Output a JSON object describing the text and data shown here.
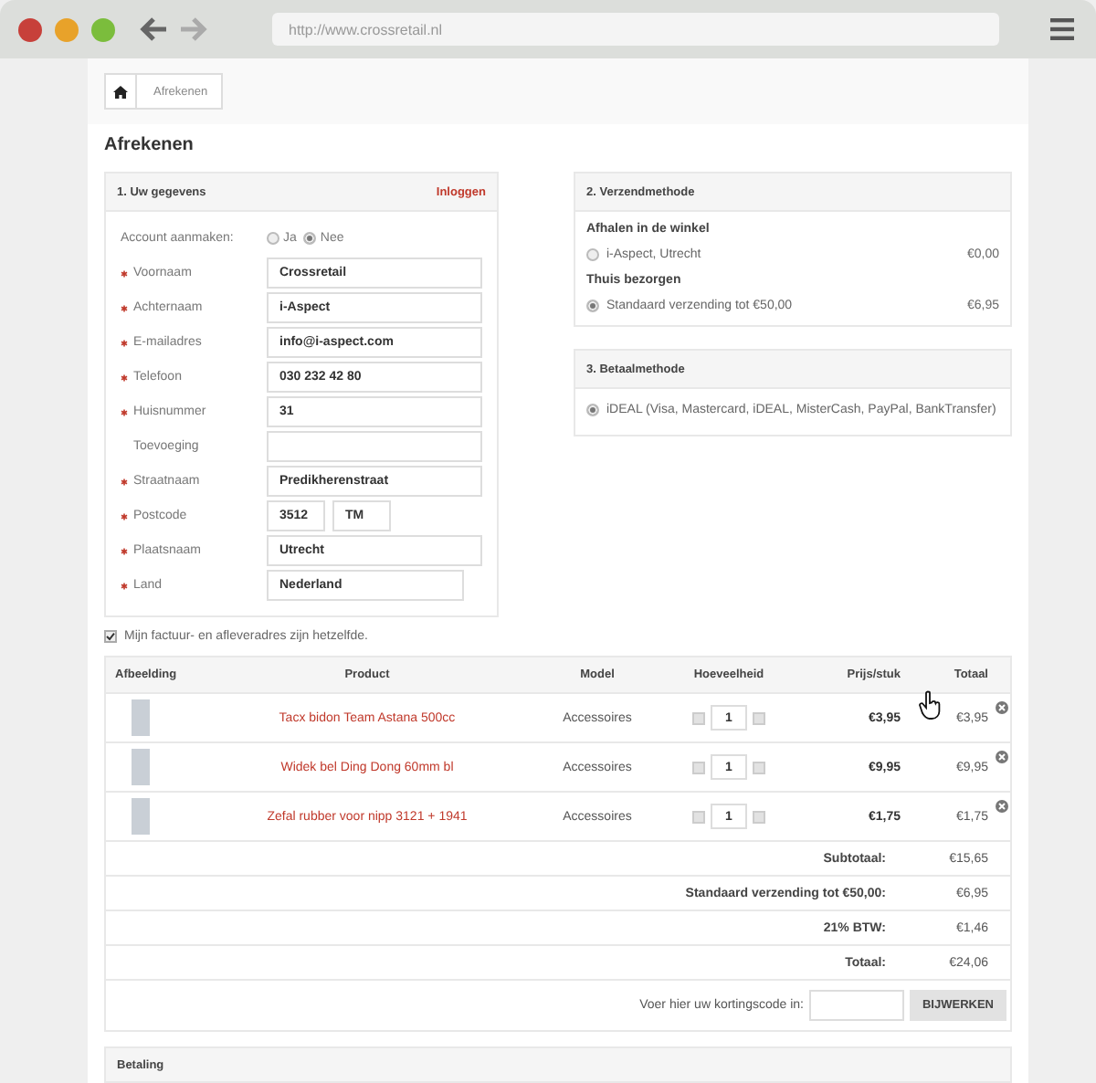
{
  "browser": {
    "url": "http://www.crossretail.nl"
  },
  "breadcrumb": {
    "current": "Afrekenen"
  },
  "title": "Afrekenen",
  "personal": {
    "title": "1. Uw gegevens",
    "login_link": "Inloggen",
    "account": {
      "label": "Account aanmaken:",
      "options": [
        {
          "label": "Ja",
          "selected": false
        },
        {
          "label": "Nee",
          "selected": true
        }
      ]
    },
    "fields": [
      {
        "kind": "text",
        "label": "Voornaam",
        "required": true,
        "value": "Crossretail"
      },
      {
        "kind": "text",
        "label": "Achternaam",
        "required": true,
        "value": "i-Aspect"
      },
      {
        "kind": "text",
        "label": "E-mailadres",
        "required": true,
        "value": "info@i-aspect.com"
      },
      {
        "kind": "text",
        "label": "Telefoon",
        "required": true,
        "value": "030 232 42 80"
      },
      {
        "kind": "text",
        "label": "Huisnummer",
        "required": true,
        "value": "31"
      },
      {
        "kind": "text",
        "label": "Toevoeging",
        "required": false
      },
      {
        "kind": "text",
        "label": "Straatnaam",
        "required": true,
        "value": "Predikherenstraat"
      },
      {
        "kind": "split",
        "label": "Postcode",
        "required": true,
        "values": [
          "3512",
          "TM"
        ]
      },
      {
        "kind": "text",
        "label": "Plaatsnaam",
        "required": true,
        "value": "Utrecht"
      },
      {
        "kind": "select",
        "label": "Land",
        "required": true,
        "value": "Nederland"
      }
    ]
  },
  "shipping": {
    "title": "2. Verzendmethode",
    "groups": [
      {
        "heading": "Afhalen in de winkel",
        "options": [
          {
            "label": "i-Aspect, Utrecht",
            "price": "€0,00",
            "selected": false
          }
        ]
      },
      {
        "heading": "Thuis bezorgen",
        "options": [
          {
            "label": "Standaard verzending tot €50,00",
            "price": "€6,95",
            "selected": true
          }
        ]
      }
    ]
  },
  "payment_method": {
    "title": "3. Betaalmethode",
    "options": [
      {
        "label": "iDEAL (Visa, Mastercard, iDEAL, MisterCash, PayPal, BankTransfer)",
        "selected": true
      }
    ]
  },
  "same_address": {
    "label": "Mijn factuur- en afleveradres zijn hetzelfde.",
    "checked": true
  },
  "cart": {
    "columns": [
      "Afbeelding",
      "Product",
      "Model",
      "Hoeveelheid",
      "Prijs/stuk",
      "Totaal"
    ],
    "rows": [
      {
        "product": "Tacx bidon Team Astana 500cc",
        "model": "Accessoires",
        "quantity": "1",
        "price": "€3,95",
        "total": "€3,95"
      },
      {
        "product": "Widek bel Ding Dong 60mm bl",
        "model": "Accessoires",
        "quantity": "1",
        "price": "€9,95",
        "total": "€9,95"
      },
      {
        "product": "Zefal rubber voor nipp 3121 + 1941",
        "model": "Accessoires",
        "quantity": "1",
        "price": "€1,75",
        "total": "€1,75"
      }
    ],
    "summary": [
      {
        "label": "Subtotaal:",
        "value": "€15,65"
      },
      {
        "label": "Standaard verzending tot €50,00:",
        "value": "€6,95"
      },
      {
        "label": "21% BTW:",
        "value": "€1,46"
      },
      {
        "label": "Totaal:",
        "value": "€24,06"
      }
    ],
    "coupon": {
      "label": "Voer hier uw kortingscode in:",
      "button": "BIJWERKEN"
    }
  },
  "payment_section": {
    "title": "Betaling"
  }
}
